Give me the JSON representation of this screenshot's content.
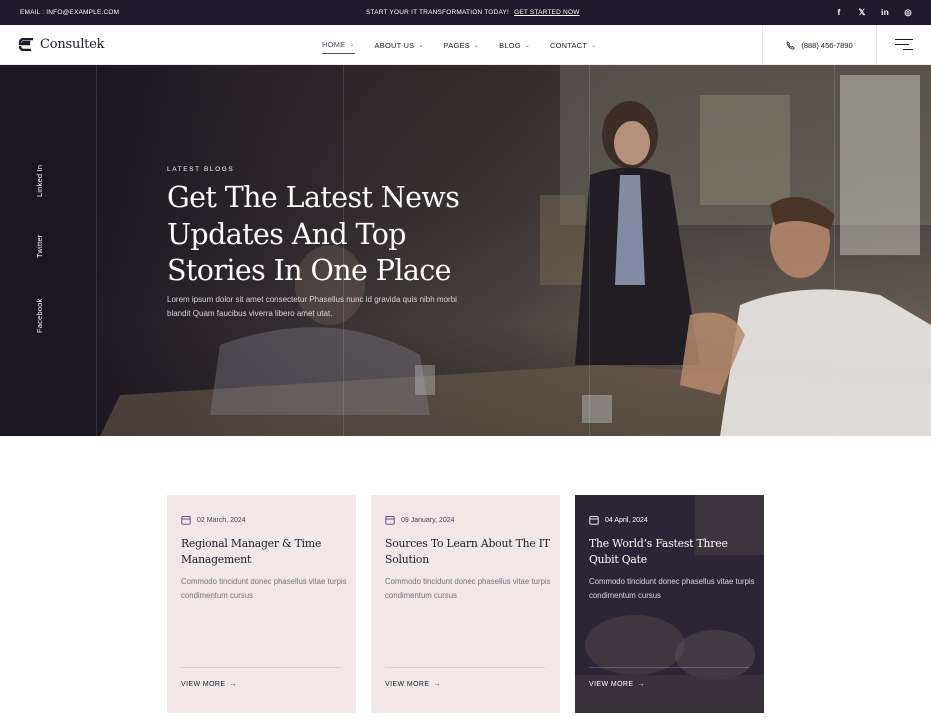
{
  "topbar": {
    "email": "EMAIL : INFO@EXAMPLE.COM",
    "promo": "START YOUR IT TRANSFORMATION TODAY!",
    "promo_link": "GET STARTED NOW",
    "socials": [
      {
        "icon": "facebook-icon",
        "glyph": "f"
      },
      {
        "icon": "x-icon",
        "glyph": "𝕏"
      },
      {
        "icon": "linkedin-icon",
        "glyph": "in"
      },
      {
        "icon": "instagram-icon",
        "glyph": "◎"
      }
    ]
  },
  "header": {
    "logo_text": "Consultek",
    "nav": [
      {
        "label": "HOME",
        "active": true
      },
      {
        "label": "ABOUT US",
        "active": false
      },
      {
        "label": "PAGES",
        "active": false
      },
      {
        "label": "BLOG",
        "active": false
      },
      {
        "label": "CONTACT",
        "active": false
      }
    ],
    "phone": "(888) 456-7890"
  },
  "hero": {
    "side_links": [
      "Linked In",
      "Twitter",
      "Facebook"
    ],
    "kicker": "LATEST BLOGS",
    "title": "Get The Latest News Updates And Top Stories In One Place",
    "lead": "Lorem ipsum dolor sit amet consectetur Phasellus nunc id gravida quis nibh morbi blandit Quam faucibus viverra libero amet utat."
  },
  "cards": [
    {
      "date": "02 March, 2024",
      "title": "Regional Manager & Time Management",
      "desc": "Commodo tincidunt donec phasellus vitae turpis condimentum cursus",
      "more": "VIEW MORE"
    },
    {
      "date": "09 January, 2024",
      "title": "Sources To Learn About The IT Solution",
      "desc": "Commodo tincidunt donec phasellus vitae turpis condimentum cursus",
      "more": "VIEW MORE"
    },
    {
      "date": "04 April, 2024",
      "title": "The World’s Fastest Three Qubit Qate",
      "desc": "Commodo tincidunt donec phasellus vitae turpis condimentum cursus",
      "more": "VIEW MORE"
    }
  ],
  "colors": {
    "dark": "#1e1a2b",
    "card_bg": "#f2e6e8",
    "accent": "#5a4a6b"
  }
}
